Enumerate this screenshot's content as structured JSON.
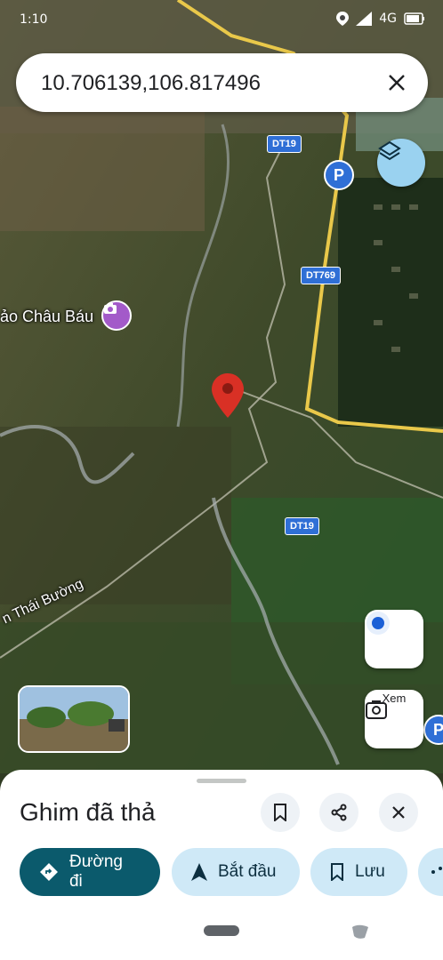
{
  "status_bar": {
    "time": "1:10",
    "network": "4G"
  },
  "search": {
    "query": "10.706139,106.817496",
    "clear_icon": "close-icon"
  },
  "map": {
    "road_labels": [
      "DT19",
      "DT769",
      "DT19"
    ],
    "place_label": "ảo Châu Báu",
    "road_name": "n Thái Bường",
    "parking_symbol": "P"
  },
  "controls": {
    "lens_label": "Xem"
  },
  "sheet": {
    "title": "Ghim đã thả",
    "actions": {
      "directions": "Đường đi",
      "start": "Bắt đầu",
      "save": "Lưu"
    }
  },
  "colors": {
    "accent_primary": "#0b5a6c",
    "chip_secondary": "#cfe9f7",
    "pin": "#d93025",
    "road": "#e9c84a"
  }
}
